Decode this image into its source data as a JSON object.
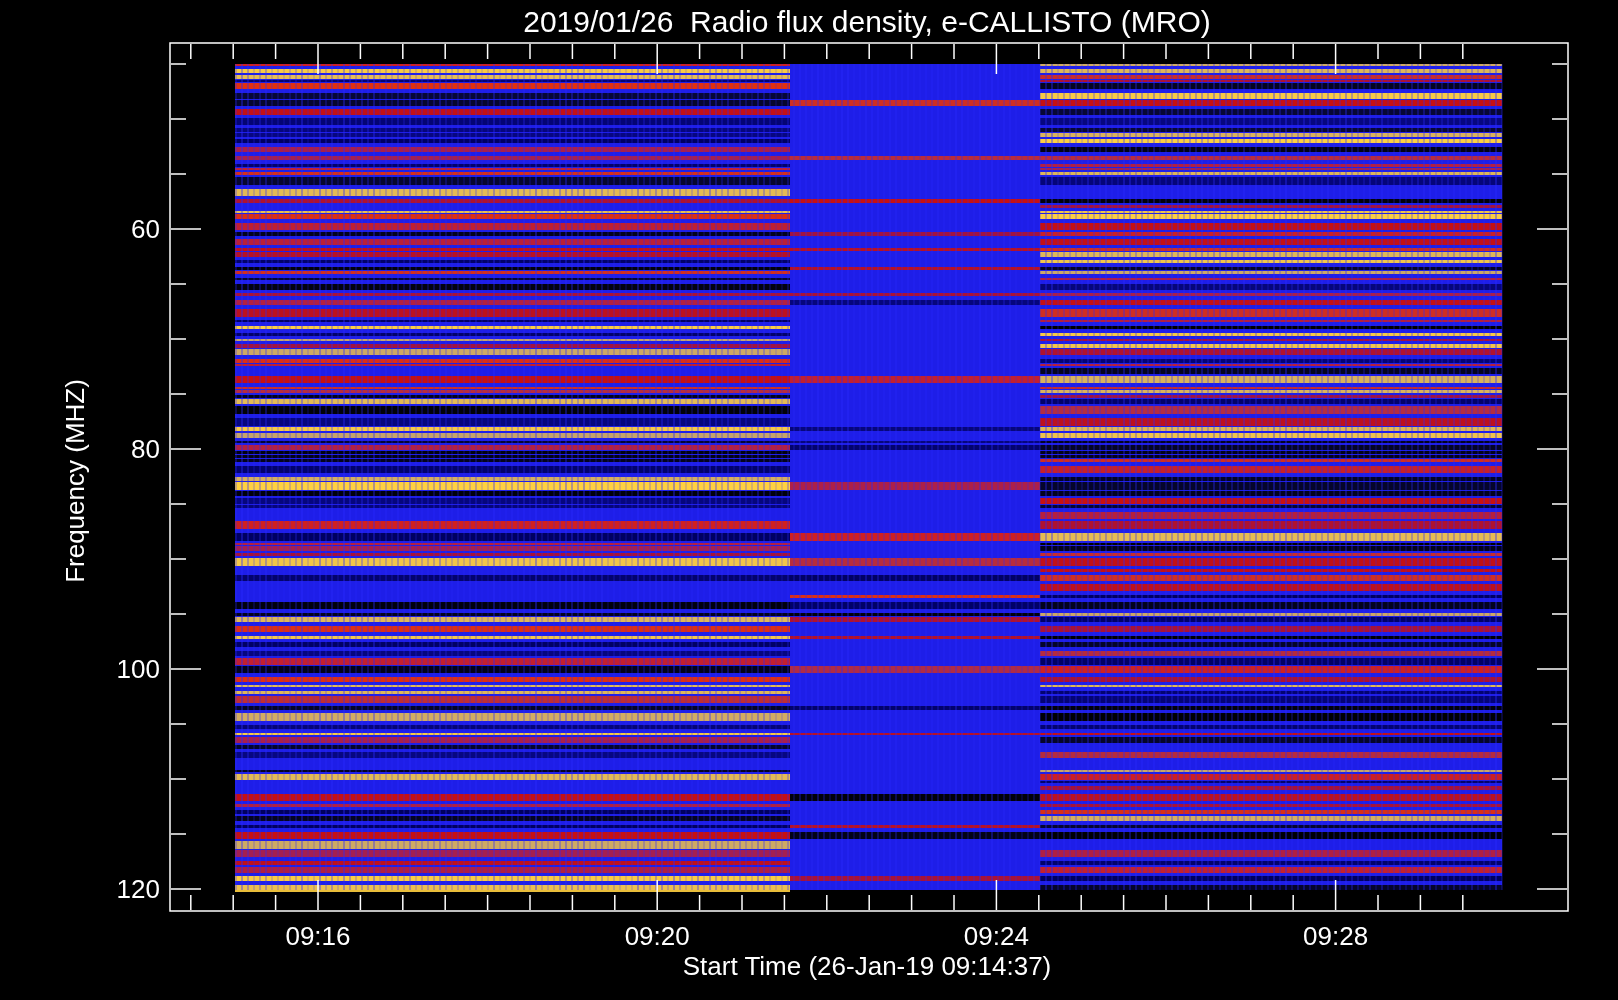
{
  "title": "2019/01/26  Radio flux density, e-CALLISTO (MRO)",
  "y_axis": {
    "label": "Frequency (MHZ)",
    "ticks": [
      "60",
      "80",
      "100",
      "120"
    ]
  },
  "x_axis": {
    "label": "Start Time (26-Jan-19 09:14:37)",
    "ticks": [
      "09:16",
      "09:20",
      "09:24",
      "09:28"
    ]
  }
}
